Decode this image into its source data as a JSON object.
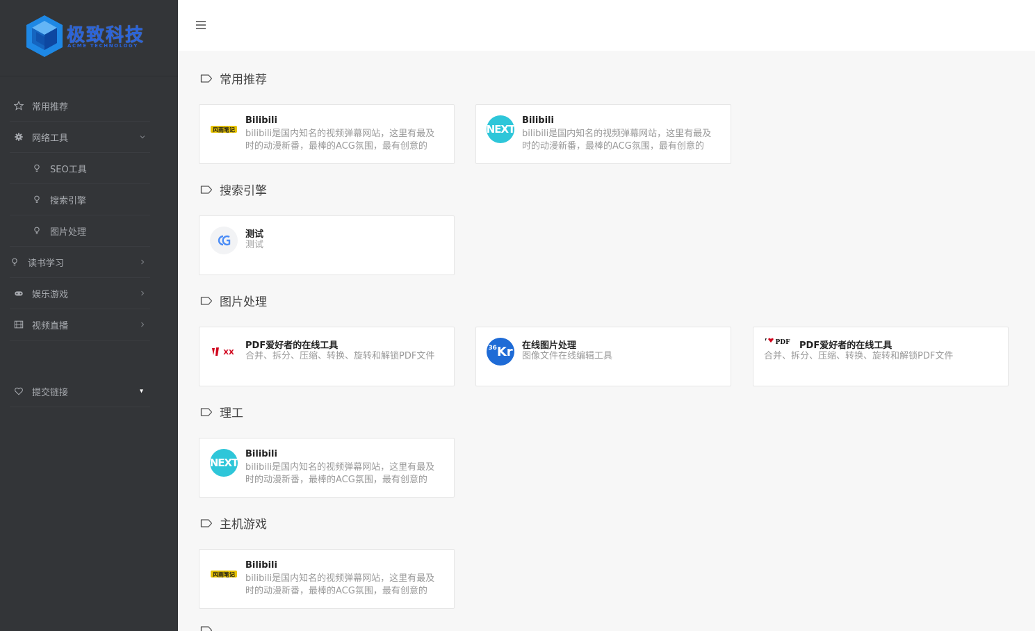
{
  "brand": {
    "name": "极致科技",
    "tagline": "ACME TECHNOLOGY"
  },
  "sidebar": {
    "items": [
      {
        "label": "常用推荐"
      },
      {
        "label": "网络工具"
      },
      {
        "label": "SEO工具"
      },
      {
        "label": "搜索引擎"
      },
      {
        "label": "图片处理"
      },
      {
        "label": "读书学习"
      },
      {
        "label": "娱乐游戏"
      },
      {
        "label": "视频直播"
      }
    ],
    "submit": {
      "label": "提交链接",
      "caret": "▾"
    }
  },
  "sections": [
    {
      "title": "常用推荐",
      "cards": [
        {
          "title": "Bilibili",
          "desc": "bilibili是国内知名的视频弹幕网站，这里有最及时的动漫新番，最棒的ACG氛围，最有创意的Up…",
          "icon": "yellow-logo"
        },
        {
          "title": "Bilibili",
          "desc": "bilibili是国内知名的视频弹幕网站，这里有最及时的动漫新番，最棒的ACG氛围，最有创意的Up…",
          "icon": "next-logo"
        }
      ]
    },
    {
      "title": "搜索引擎",
      "cards": [
        {
          "title": "测试",
          "desc": "测试",
          "icon": "cg-logo"
        }
      ]
    },
    {
      "title": "图片处理",
      "cards": [
        {
          "title": "PDF爱好者的在线工具",
          "desc": "合并、拆分、压缩、转换、旋转和解锁PDF文件",
          "icon": "red-logo"
        },
        {
          "title": "在线图片处理",
          "desc": "图像文件在线编辑工具",
          "icon": "36kr-logo"
        },
        {
          "title": "PDF爱好者的在线工具",
          "desc": "合并、拆分、压缩、转换、旋转和解锁PDF文件",
          "icon": "pdf-logo"
        }
      ]
    },
    {
      "title": "理工",
      "cards": [
        {
          "title": "Bilibili",
          "desc": "bilibili是国内知名的视频弹幕网站，这里有最及时的动漫新番，最棒的ACG氛围，最有创意的Up…",
          "icon": "next-logo"
        }
      ]
    },
    {
      "title": "主机游戏",
      "cards": [
        {
          "title": "Bilibili",
          "desc": "bilibili是国内知名的视频弹幕网站，这里有最及时的动漫新番，最棒的ACG氛围，最有创意的Up…",
          "icon": "yellow-logo"
        }
      ]
    }
  ],
  "logos": {
    "next": "NEXT",
    "kr_num": "36",
    "kr": "Kr",
    "pdf": "PDF",
    "yellow": "风雨笔记"
  },
  "colors": {
    "sidebar": "#333538",
    "brand_blue": "#2a63d9",
    "next_teal": "#2ec6d9"
  }
}
